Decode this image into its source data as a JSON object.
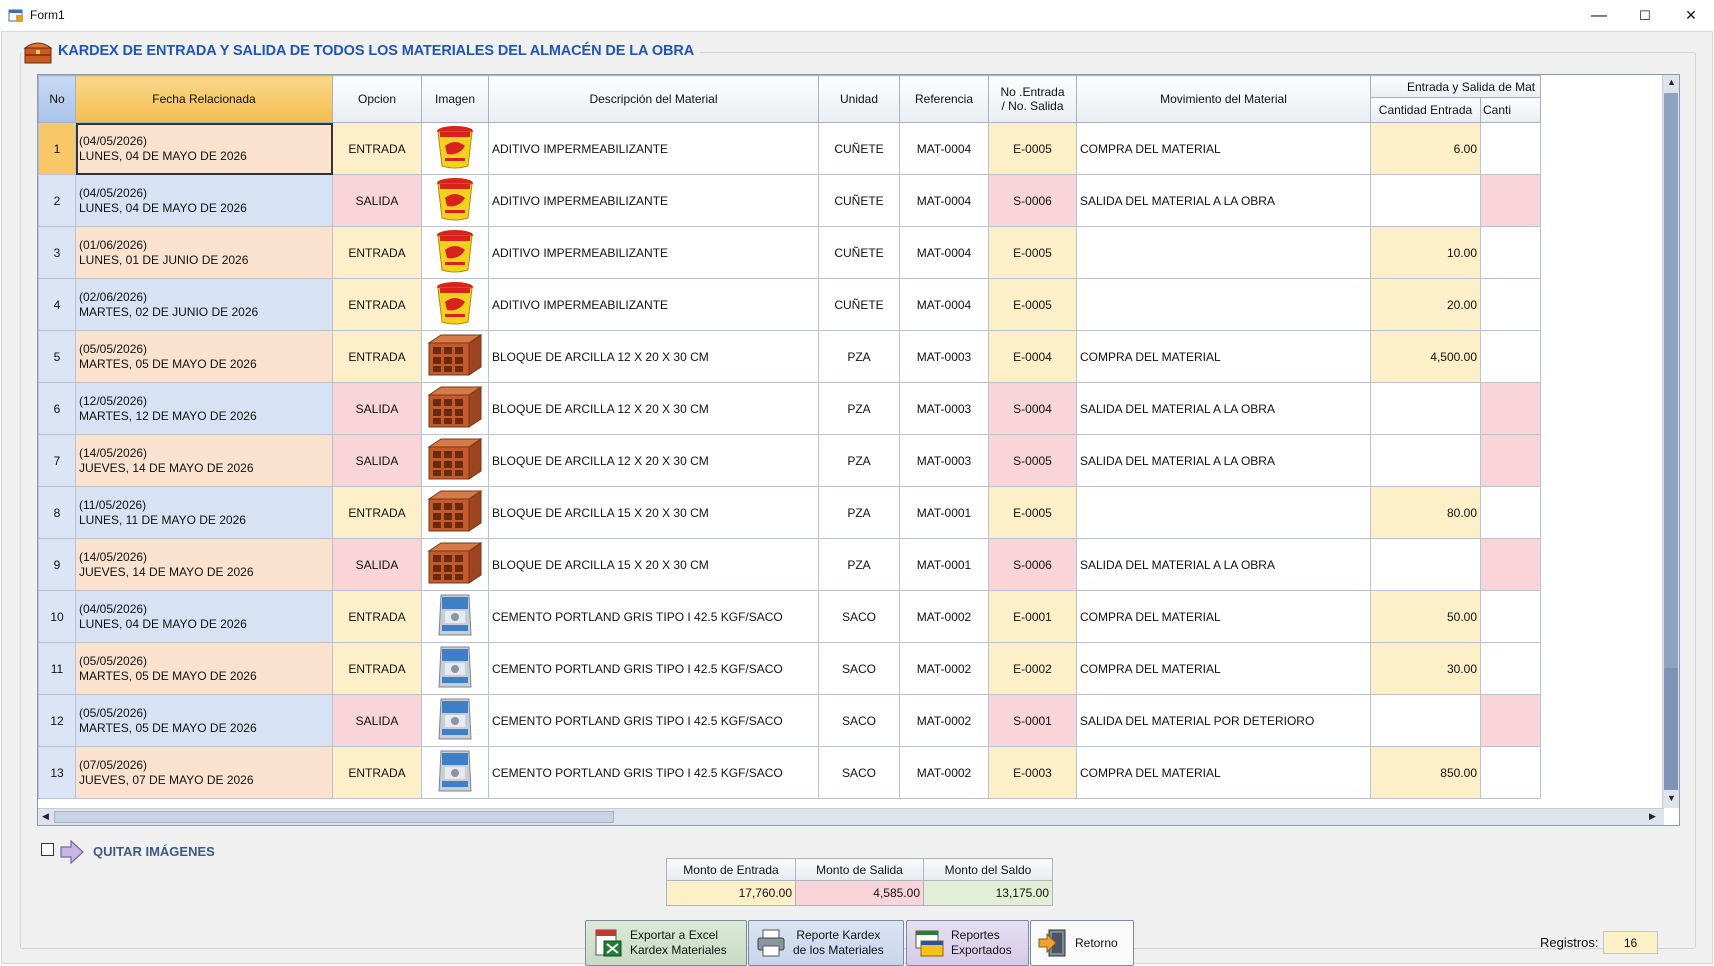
{
  "window": {
    "title": "Form1",
    "minimize_glyph": "—",
    "maximize_glyph": "☐",
    "close_glyph": "✕"
  },
  "heading": "KARDEX DE ENTRADA Y  SALIDA DE TODOS LOS MATERIALES  DEL ALMACÉN DE LA OBRA",
  "grid": {
    "columns": {
      "no": "No",
      "fecha": "Fecha Relacionada",
      "opcion": "Opcion",
      "imagen": "Imagen",
      "descripcion": "Descripción del Material",
      "unidad": "Unidad",
      "referencia": "Referencia",
      "no_entrada_line1": "No .Entrada",
      "no_entrada_line2": "/ No. Salida",
      "movimiento": "Movimiento del Material",
      "group": "Entrada y Salida de Mat",
      "cant_entrada": "Cantidad Entrada",
      "cant_salida": "Canti"
    },
    "rows": [
      {
        "no": "1",
        "fecha1": "(04/05/2026)",
        "fecha2": "LUNES, 04 DE MAYO DE 2026",
        "opcion": "ENTRADA",
        "img": "bucket",
        "desc": "ADITIVO IMPERMEABILIZANTE",
        "unidad": "CUÑETE",
        "ref": "MAT-0004",
        "nes": "E-0005",
        "mov": "COMPRA DEL MATERIAL",
        "entrada": "6.00"
      },
      {
        "no": "2",
        "fecha1": "(04/05/2026)",
        "fecha2": "LUNES, 04 DE MAYO DE 2026",
        "opcion": "SALIDA",
        "img": "bucket",
        "desc": "ADITIVO IMPERMEABILIZANTE",
        "unidad": "CUÑETE",
        "ref": "MAT-0004",
        "nes": "S-0006",
        "mov": "SALIDA DEL MATERIAL A LA OBRA",
        "entrada": ""
      },
      {
        "no": "3",
        "fecha1": "(01/06/2026)",
        "fecha2": "LUNES, 01 DE JUNIO DE 2026",
        "opcion": "ENTRADA",
        "img": "bucket",
        "desc": "ADITIVO IMPERMEABILIZANTE",
        "unidad": "CUÑETE",
        "ref": "MAT-0004",
        "nes": "E-0005",
        "mov": "",
        "entrada": "10.00"
      },
      {
        "no": "4",
        "fecha1": "(02/06/2026)",
        "fecha2": "MARTES, 02 DE JUNIO DE 2026",
        "opcion": "ENTRADA",
        "img": "bucket",
        "desc": "ADITIVO IMPERMEABILIZANTE",
        "unidad": "CUÑETE",
        "ref": "MAT-0004",
        "nes": "E-0005",
        "mov": "",
        "entrada": "20.00"
      },
      {
        "no": "5",
        "fecha1": "(05/05/2026)",
        "fecha2": "MARTES, 05 DE MAYO DE 2026",
        "opcion": "ENTRADA",
        "img": "brick",
        "desc": "BLOQUE DE ARCILLA 12 X 20 X 30 CM",
        "unidad": "PZA",
        "ref": "MAT-0003",
        "nes": "E-0004",
        "mov": "COMPRA DEL MATERIAL",
        "entrada": "4,500.00"
      },
      {
        "no": "6",
        "fecha1": "(12/05/2026)",
        "fecha2": "MARTES, 12 DE MAYO DE 2026",
        "opcion": "SALIDA",
        "img": "brick",
        "desc": "BLOQUE DE ARCILLA 12 X 20 X 30 CM",
        "unidad": "PZA",
        "ref": "MAT-0003",
        "nes": "S-0004",
        "mov": "SALIDA DEL MATERIAL A LA OBRA",
        "entrada": ""
      },
      {
        "no": "7",
        "fecha1": "(14/05/2026)",
        "fecha2": "JUEVES, 14 DE MAYO DE 2026",
        "opcion": "SALIDA",
        "img": "brick",
        "desc": "BLOQUE DE ARCILLA 12 X 20 X 30 CM",
        "unidad": "PZA",
        "ref": "MAT-0003",
        "nes": "S-0005",
        "mov": "SALIDA DEL MATERIAL A LA OBRA",
        "entrada": ""
      },
      {
        "no": "8",
        "fecha1": "(11/05/2026)",
        "fecha2": "LUNES, 11 DE MAYO DE 2026",
        "opcion": "ENTRADA",
        "img": "brick",
        "desc": "BLOQUE DE ARCILLA 15 X 20 X 30 CM",
        "unidad": "PZA",
        "ref": "MAT-0001",
        "nes": "E-0005",
        "mov": "",
        "entrada": "80.00"
      },
      {
        "no": "9",
        "fecha1": "(14/05/2026)",
        "fecha2": "JUEVES, 14 DE MAYO DE 2026",
        "opcion": "SALIDA",
        "img": "brick",
        "desc": "BLOQUE DE ARCILLA 15 X 20 X 30 CM",
        "unidad": "PZA",
        "ref": "MAT-0001",
        "nes": "S-0006",
        "mov": "SALIDA DEL MATERIAL A LA OBRA",
        "entrada": ""
      },
      {
        "no": "10",
        "fecha1": "(04/05/2026)",
        "fecha2": "LUNES, 04 DE MAYO DE 2026",
        "opcion": "ENTRADA",
        "img": "sack",
        "desc": "CEMENTO PORTLAND GRIS TIPO I 42.5 KGF/SACO",
        "unidad": "SACO",
        "ref": "MAT-0002",
        "nes": "E-0001",
        "mov": "COMPRA DEL MATERIAL",
        "entrada": "50.00"
      },
      {
        "no": "11",
        "fecha1": "(05/05/2026)",
        "fecha2": "MARTES, 05 DE MAYO DE 2026",
        "opcion": "ENTRADA",
        "img": "sack",
        "desc": "CEMENTO PORTLAND GRIS TIPO I 42.5 KGF/SACO",
        "unidad": "SACO",
        "ref": "MAT-0002",
        "nes": "E-0002",
        "mov": "COMPRA DEL MATERIAL",
        "entrada": "30.00"
      },
      {
        "no": "12",
        "fecha1": "(05/05/2026)",
        "fecha2": "MARTES, 05 DE MAYO DE 2026",
        "opcion": "SALIDA",
        "img": "sack",
        "desc": "CEMENTO PORTLAND GRIS TIPO I 42.5 KGF/SACO",
        "unidad": "SACO",
        "ref": "MAT-0002",
        "nes": "S-0001",
        "mov": "SALIDA DEL MATERIAL POR DETERIORO",
        "entrada": ""
      },
      {
        "no": "13",
        "fecha1": "(07/05/2026)",
        "fecha2": "JUEVES, 07 DE MAYO DE 2026",
        "opcion": "ENTRADA",
        "img": "sack",
        "desc": "CEMENTO PORTLAND GRIS TIPO I 42.5 KGF/SACO",
        "unidad": "SACO",
        "ref": "MAT-0002",
        "nes": "E-0003",
        "mov": "COMPRA DEL MATERIAL",
        "entrada": "850.00"
      }
    ]
  },
  "quitar_imagenes": {
    "label": "QUITAR IMÁGENES",
    "checked": false
  },
  "montos": {
    "entrada_label": "Monto de Entrada",
    "salida_label": "Monto de Salida",
    "saldo_label": "Monto del Saldo",
    "entrada": "17,760.00",
    "salida": "4,585.00",
    "saldo": "13,175.00"
  },
  "buttons": {
    "exportar_line1": "Exportar a Excel",
    "exportar_line2": "Kardex Materiales",
    "reporte_line1": "Reporte Kardex",
    "reporte_line2": "de los Materiales",
    "reportes_line1": "Reportes",
    "reportes_line2": "Exportados",
    "retorno": "Retorno"
  },
  "registros": {
    "label": "Registros:",
    "value": "16"
  },
  "colors": {
    "accent_blue": "#1f56b5",
    "entrada_bg": "#fdf0c8",
    "salida_bg": "#f9d5d9",
    "saldo_bg": "#e3eed6"
  }
}
